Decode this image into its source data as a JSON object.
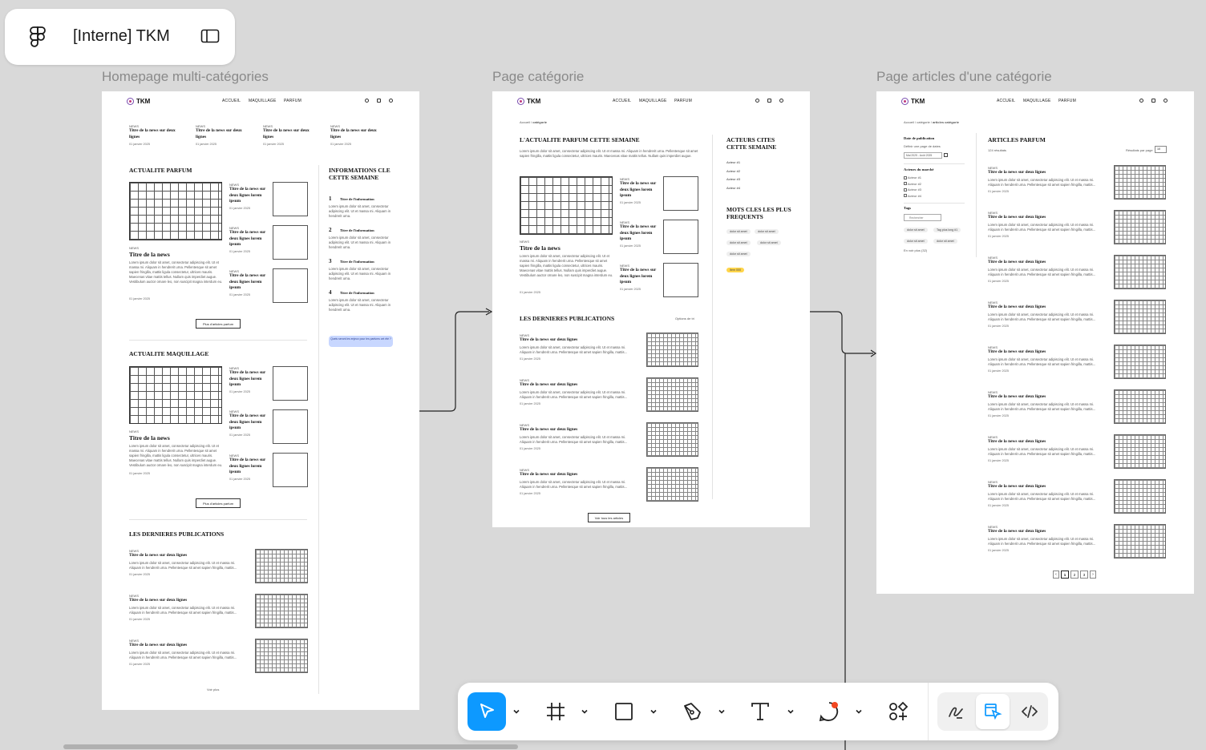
{
  "file": {
    "name": "[Interne] TKM"
  },
  "frames": {
    "homepage": {
      "label": "Homepage multi-catégories"
    },
    "category": {
      "label": "Page catégorie"
    },
    "articles": {
      "label": "Page articles d'une catégorie"
    }
  },
  "site": {
    "logo": "TKM",
    "nav": [
      "ACCUEIL",
      "MAQUILLAGE",
      "PARFUM"
    ],
    "tag": "NEWS",
    "date": "01 janvier 2025",
    "title_short": "Titre de la news",
    "title_two_lines": "Titre de la news sur deux lignes",
    "title_lorem": "Titre de la news sur deux lignes lorem ipsum",
    "body_long": "Lorem ipsum dolor sit amet, consectetur adipiscing elit. Ut et massa mi. Aliquam in hendrerit urna. Pellentesque sit amet sapien fringilla, mattis ligula consectetur, ultrices mauris. Maecenas vitae mattis tellus. Nullam quis imperdiet augue. Vestibulum auctor ornare leo, non suscipit magna interdum eu.",
    "body_short": "Lorem ipsum dolor sit amet, consectetur adipiscing elit. Ut et massa mi. Aliquam in hendrerit urna. Pellentesque sit amet sapien fringilla, mattis...",
    "body_info": "Lorem ipsum dolor sit amet, consectetur adipiscing elit. Ut et massa mi. Aliquam in hendrerit urna."
  },
  "homepage": {
    "sec_parfum": "ACTUALITE PARFUM",
    "sec_maquillage": "ACTUALITE MAQUILLAGE",
    "sec_latest": "LES DERNIERES PUBLICATIONS",
    "sec_info": "INFORMATIONS CLE CETTE SEMAINE",
    "info_items": [
      {
        "num": "1",
        "title": "Titre de l'information"
      },
      {
        "num": "2",
        "title": "Titre de l'information"
      },
      {
        "num": "3",
        "title": "Titre de l'information"
      },
      {
        "num": "4",
        "title": "Titre de l'information"
      }
    ],
    "more_parfum": "Plus d'articles parfum",
    "more_maquillage": "Plus d'articles parfum",
    "load_more": "Voir plus",
    "newsletter": "Quels seront les enjeux pour les parfums cet été ?"
  },
  "category": {
    "breadcrumb_home": "Accueil",
    "breadcrumb_current": "catégorie",
    "sec_week": "L'ACTUALITE PARFUM CETTE SEMAINE",
    "intro": "Lorem ipsum dolor sit amet, consectetur adipiscing elit. Ut et massa mi. Aliquam in hendrerit urna. Pellentesque sit amet sapien fringilla, mattis ligula consectetur, ultrices mauris. Maecenas vitae mattis tellus. Nullam quis imperdiet augue.",
    "sec_actors": "ACTEURS CITES CETTE SEMAINE",
    "actors": [
      "Acteur #1",
      "Acteur #2",
      "Acteur #3",
      "Acteur #4"
    ],
    "sec_keywords": "MOTS CLES LES PLUS FREQUENTS",
    "keywords": [
      "dolor sit amet",
      "dolor sit amet",
      "dolor sit amet",
      "dolor sit amet",
      "dolor sit amet"
    ],
    "highlight_chip": "Item 000",
    "sec_latest": "LES DERNIERES PUBLICATIONS",
    "sort": "Options de tri",
    "see_all": "Voir tous les articles"
  },
  "articles": {
    "breadcrumb_home": "Accueil",
    "breadcrumb_cat": "catégorie",
    "breadcrumb_current": "articles catégorie",
    "title": "ARTICLES PARFUM",
    "count": "124 résultats",
    "per_page_label": "Résultats par page",
    "per_page_value": "10",
    "filter_date": "Date de publication",
    "filter_date_hint": "Définir une page de dates",
    "filter_date_value": "Mai 2025 - Août 2025",
    "filter_actors": "Acteurs du marché",
    "actors": [
      "Acteur #1",
      "Acteur #2",
      "Acteur #3",
      "Acteur #4"
    ],
    "filter_tags": "Tags",
    "tag_search_placeholder": "Rechercher",
    "tags": [
      "dolor sit amet",
      "Tag plus long #1",
      "dolor sit amet",
      "dolor sit amet"
    ],
    "see_more_tags": "En voir plus (32)",
    "pages": [
      "1",
      "2",
      "3"
    ]
  },
  "toolbar": {
    "tools": [
      "move-tool",
      "frame-tool",
      "rectangle-tool",
      "pen-tool",
      "text-tool",
      "comment-tool",
      "assets-tool"
    ],
    "modes": [
      "draw-mode",
      "design-mode",
      "dev-mode"
    ],
    "accent": "#0d99ff"
  }
}
